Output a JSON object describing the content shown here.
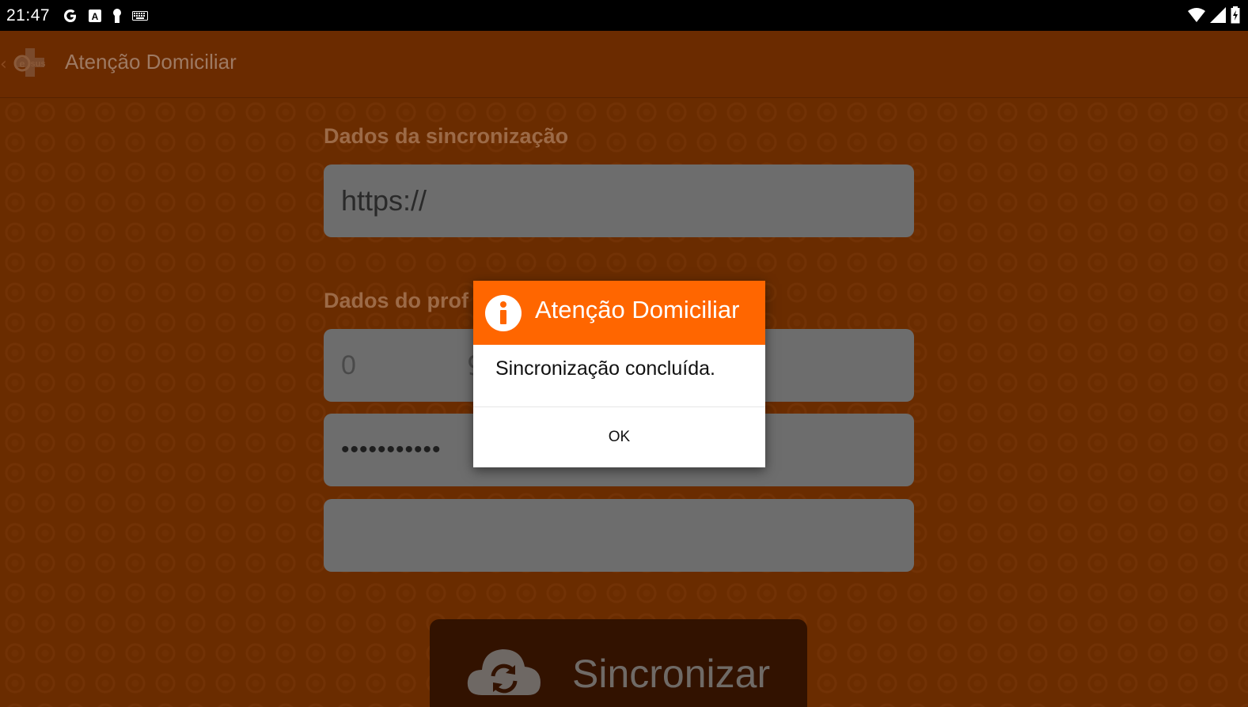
{
  "status_bar": {
    "time": "21:47",
    "left_icons": [
      "google-icon",
      "keyboard-a-icon",
      "keyhole-icon",
      "keyboard-icon"
    ],
    "right_icons": [
      "wifi-icon",
      "signal-icon",
      "battery-icon"
    ]
  },
  "app_bar": {
    "title": "Atenção Domiciliar",
    "logo_text": "sus",
    "colors": {
      "background": "#6b2b00",
      "title": "#9e7a63"
    }
  },
  "form": {
    "sync_section_label": "Dados da sincronização",
    "url_value": "https://",
    "professional_section_label": "Dados do prof",
    "username_value": "0",
    "username_ghost": "9",
    "password_value": "•••••••••••"
  },
  "sync_button": {
    "label": "Sincronizar",
    "icon": "cloud-sync-icon"
  },
  "dialog": {
    "title": "Atenção Domiciliar",
    "icon": "info-icon",
    "message": "Sincronização concluída.",
    "ok_label": "OK",
    "colors": {
      "header": "#ff6600",
      "body": "#ffffff"
    }
  }
}
